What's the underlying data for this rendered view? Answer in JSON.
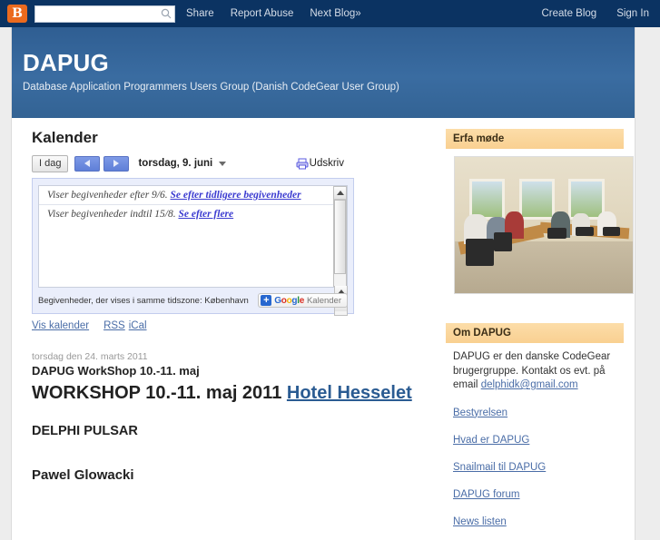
{
  "navbar": {
    "logo_letter": "B",
    "search_placeholder": "",
    "search_value": "",
    "search_icon": "search-icon",
    "links": [
      {
        "label": "Share"
      },
      {
        "label": "Report Abuse"
      },
      {
        "label": "Next Blog»"
      }
    ],
    "right_links": [
      {
        "label": "Create Blog"
      },
      {
        "label": "Sign In"
      }
    ]
  },
  "header": {
    "title": "DAPUG",
    "description": "Database Application Programmers Users Group (Danish CodeGear User Group)"
  },
  "calendar": {
    "gadget_title": "Kalender",
    "today_label": "I dag",
    "prev_label": "prev",
    "next_label": "next",
    "current_date": "torsdag, 9. juni",
    "print_label": "Udskriv",
    "messages": [
      {
        "text": "Viser begivenheder efter 9/6. ",
        "link": "Se efter tidligere begivenheder"
      },
      {
        "text": "Viser begivenheder indtil 15/8. ",
        "link": "Se efter flere"
      }
    ],
    "timezone_note": "Begivenheder, der vises i samme tidszone: København",
    "badge": {
      "plus": "+",
      "brand": "Google",
      "product": "Kalender"
    },
    "links": [
      {
        "label": "Vis kalender"
      },
      {
        "label": "RSS"
      },
      {
        "label": "iCal"
      }
    ]
  },
  "post": {
    "date": "torsdag den 24. marts 2011",
    "title": "DAPUG WorkShop 10.-11. maj",
    "heading": "WORKSHOP 10.-11. maj 2011 ",
    "heading_link": "Hotel Hesselet",
    "subheading": "DELPHI PULSAR",
    "speaker": "Pawel Glowacki"
  },
  "sidebar": {
    "sections": [
      {
        "title": "Erfa møde",
        "image_alt": "meeting-room-photo"
      },
      {
        "title": "Om DAPUG",
        "body_text": "DAPUG er den danske CodeGear brugergruppe. Kontakt os evt. på email ",
        "body_email": "delphidk@gmail.com",
        "links": [
          {
            "label": "Bestyrelsen"
          },
          {
            "label": "Hvad er DAPUG"
          },
          {
            "label": "Snailmail til DAPUG"
          },
          {
            "label": "DAPUG forum"
          },
          {
            "label": "News listen"
          }
        ]
      }
    ]
  },
  "colors": {
    "navbar_bg": "#0b3362",
    "header_bg": "#36669a",
    "accent_orange": "#eb6a1e",
    "sidebar_head_bg": "#fbd79a",
    "link_blue": "#4a6da7",
    "calendar_bg": "#eaeefb"
  }
}
